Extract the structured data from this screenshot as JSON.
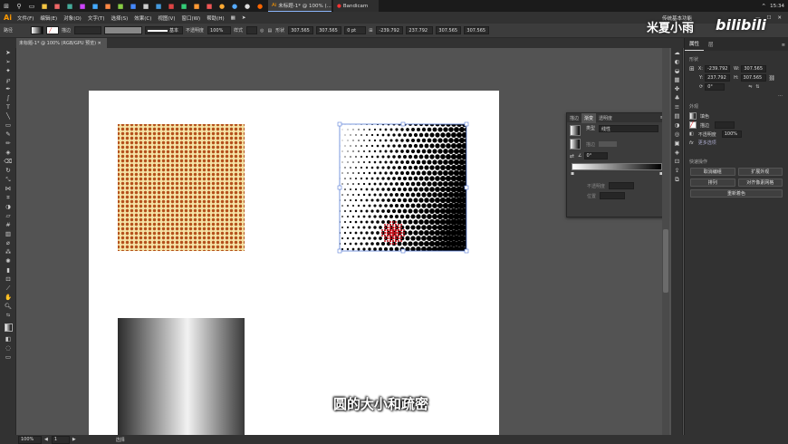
{
  "taskbar": {
    "apps": [
      "未标题-1* @ 100% (...",
      "Bandicam"
    ],
    "time": "15:34"
  },
  "app_logo": "Ai",
  "menu": [
    "文件(F)",
    "编辑(E)",
    "对象(O)",
    "文字(T)",
    "选择(S)",
    "效果(C)",
    "视图(V)",
    "窗口(W)",
    "帮助(H)"
  ],
  "workspace": "传统基本功能",
  "control": {
    "label_path": "路径",
    "stroke_label": "描边",
    "style_label": "基本",
    "opacity_label": "不透明度",
    "opacity_value": "100%",
    "style2_label": "样式",
    "shape_label": "形状",
    "w_value": "307.565",
    "h_value": "307.565",
    "pt_value": "0 pt",
    "x_value": "-239.792",
    "y_value": "237.792",
    "w2_value": "307.565",
    "h2_value": "307.565"
  },
  "doc_tab": "未标题-1* @ 100% (RGB/GPU 预览)",
  "status": {
    "zoom": "100%",
    "page": "1",
    "mode": "选择"
  },
  "properties": {
    "tabs": [
      "属性",
      "层"
    ],
    "section_shape": "形状",
    "x": "-239.792",
    "y": "237.792",
    "w": "307.565",
    "h": "307.565",
    "angle": "0°",
    "section_appearance": "外观",
    "fill_label": "填色",
    "stroke_label": "描边",
    "opacity_label": "不透明度",
    "opacity_value": "100%",
    "fx_label": "fx",
    "more_label": "更多选项",
    "section_quick": "快速操作",
    "buttons": [
      "取消编组",
      "扩展外观",
      "排列",
      "对齐像素网格",
      "重新着色"
    ]
  },
  "gradient_panel": {
    "tabs": [
      "描边",
      "渐变",
      "透明度"
    ],
    "type_label": "类型",
    "type_value": "线性",
    "stroke_label": "描边",
    "angle_value": "0°",
    "opacity_label": "不透明度",
    "location_label": "位置"
  },
  "subtitle": "圆的大小和疏密",
  "watermark": {
    "cn": "米夏小雨",
    "logo": "bilibili"
  }
}
